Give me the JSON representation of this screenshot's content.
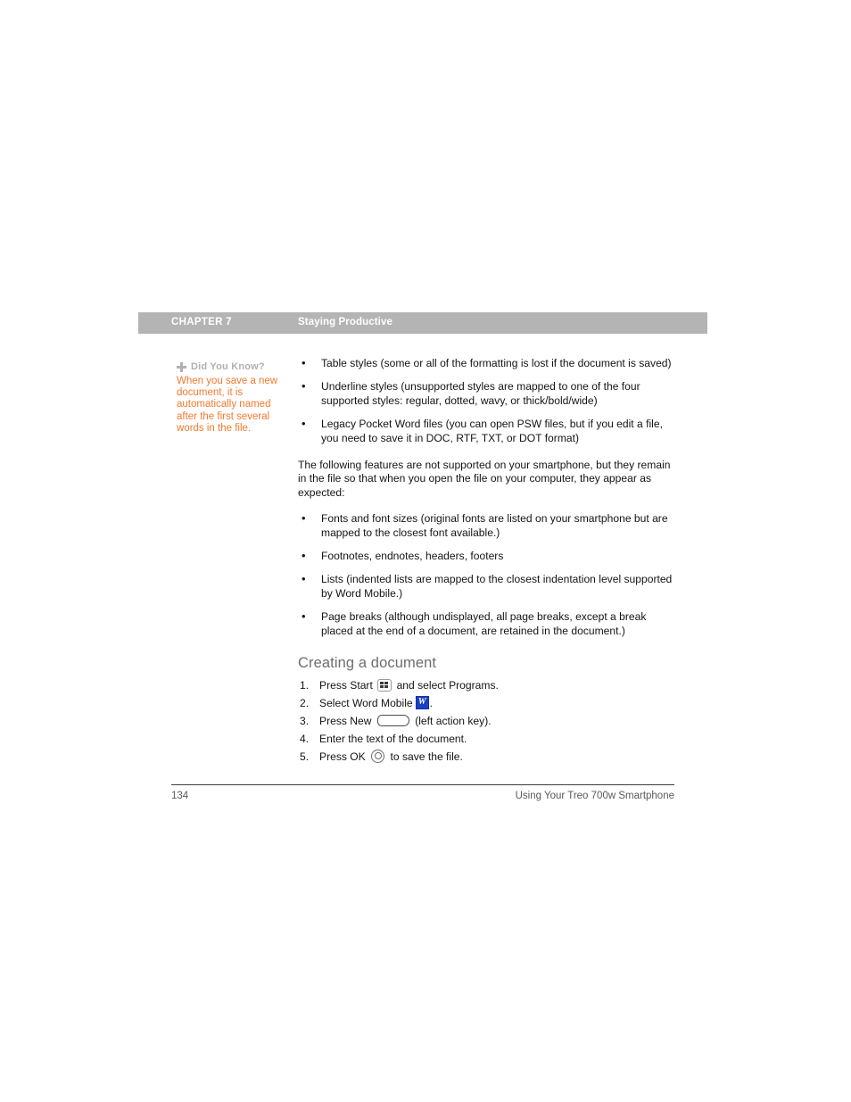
{
  "header": {
    "chapter_label": "CHAPTER 7",
    "chapter_title": "Staying Productive",
    "bar_color": "#b4b4b4",
    "text_color": "#ffffff"
  },
  "sidenote": {
    "icon": "plus-icon",
    "title": "Did You Know?",
    "body": "When you save a new document, it is automatically named after the first several words in the file.",
    "title_color": "#b0b0b0",
    "body_color": "#f4792e"
  },
  "main": {
    "unsupported_list": [
      "Table styles (some or all of the formatting is lost if the document is saved)",
      "Underline styles (unsupported styles are mapped to one of the four supported styles: regular, dotted, wavy, or thick/bold/wide)",
      "Legacy Pocket Word files (you can open PSW files, but if you edit a file, you need to save it in DOC, RTF, TXT, or DOT format)"
    ],
    "paragraph": "The following features are not supported on your smartphone, but they remain in the file so that when you open the file on your computer, they appear as expected:",
    "retained_list": [
      "Fonts and font sizes (original fonts are listed on your smartphone but are mapped to the closest font available.)",
      "Footnotes, endnotes, headers, footers",
      "Lists (indented lists are mapped to the closest indentation level supported by Word Mobile.)",
      "Page breaks (although undisplayed, all page breaks, except a break placed at the end of a document, are retained in the document.)"
    ],
    "section_heading": "Creating a document",
    "heading_color": "#6e6e6e",
    "steps": [
      {
        "number": "1.",
        "text_before": "Press Start",
        "icon": "start-key-icon",
        "text_after": "and select Programs."
      },
      {
        "number": "2.",
        "text_before": "Select Word Mobile",
        "icon": "word-mobile-icon",
        "icon_letter": "W",
        "text_after": "."
      },
      {
        "number": "3.",
        "text_before": "Press New",
        "icon": "left-action-key-icon",
        "text_after": "(left action key)."
      },
      {
        "number": "4.",
        "text_before": "Enter the text of the document.",
        "icon": "",
        "text_after": ""
      },
      {
        "number": "5.",
        "text_before": "Press OK",
        "icon": "ok-key-icon",
        "text_after": "to save the file."
      }
    ]
  },
  "footer": {
    "page_number": "134",
    "book_title": "Using Your Treo 700w Smartphone",
    "text_color": "#595959"
  }
}
